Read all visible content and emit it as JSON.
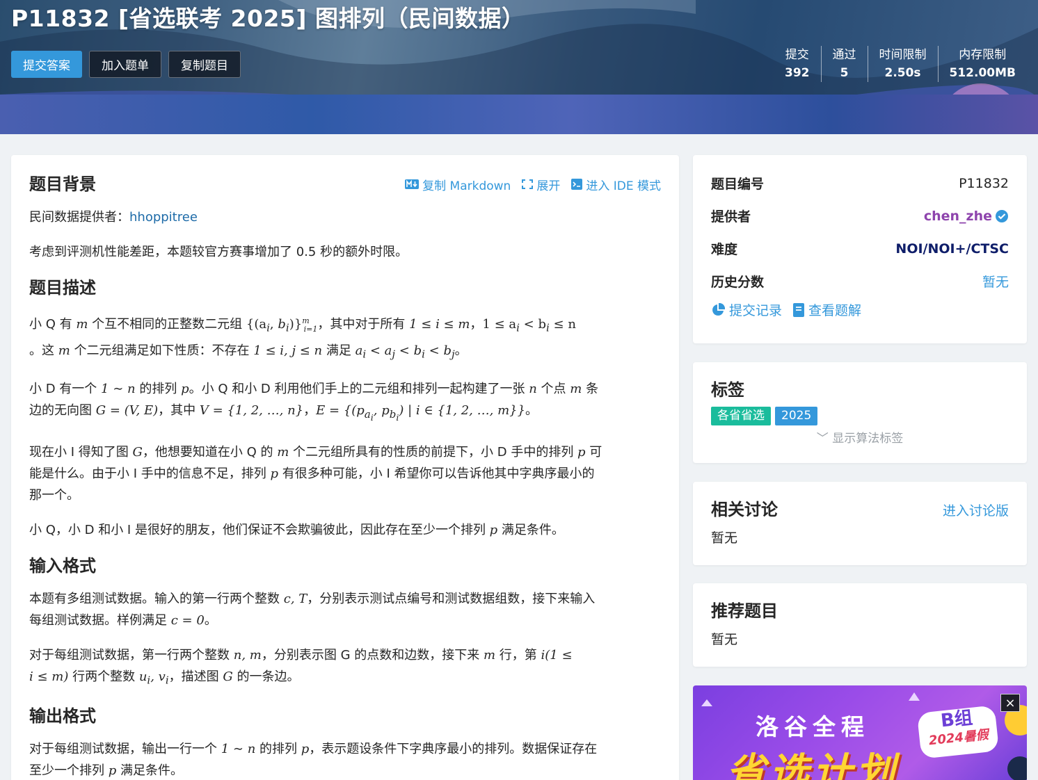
{
  "banner": {
    "title": "P11832 [省选联考 2025] 图排列（民间数据）",
    "buttons": {
      "submit": "提交答案",
      "add_list": "加入题单",
      "copy": "复制题目"
    },
    "stats": [
      {
        "label": "提交",
        "value": "392"
      },
      {
        "label": "通过",
        "value": "5"
      },
      {
        "label": "时间限制",
        "value": "2.50s"
      },
      {
        "label": "内存限制",
        "value": "512.00MB"
      }
    ]
  },
  "main": {
    "tools": {
      "copy_md": "复制 Markdown",
      "expand": "展开",
      "ide": "进入 IDE 模式"
    },
    "background": {
      "heading": "题目背景",
      "provider_prefix": "民间数据提供者：",
      "provider_name": "hhoppitree",
      "note": "考虑到评测机性能差距，本题较官方赛事增加了 0.5 秒的额外时限。"
    },
    "description": {
      "heading": "题目描述",
      "p1a": "小 Q 有 ",
      "p1b": " 个互不相同的正整数二元组 ",
      "p1c": "，其中对于所有 ",
      "p1d": "，",
      "p1e": "。这 ",
      "p1f": " 个二元组满足如下性质：不存在 ",
      "p1g": " 满足 ",
      "p1h": "。",
      "p2a": "小 D 有一个 ",
      "p2b": " 的排列 ",
      "p2c": "。小 Q 和小 D 利用他们手上的二元组和排列一起构建了一张 ",
      "p2d": " 个点 ",
      "p2e": " 条",
      "p2f": "边的无向图 ",
      "p2g": "，其中 ",
      "p2h": "，",
      "p2i": "。",
      "p3a": "现在小 I 得知了图 ",
      "p3b": "，他想要知道在小 Q 的 ",
      "p3c": " 个二元组所具有的性质的前提下，小 D 手中的排列 ",
      "p3d": " 可",
      "p3e": "能是什么。由于小 I 手中的信息不足，排列 ",
      "p3f": " 有很多种可能，小 I 希望你可以告诉他其中字典序最小的",
      "p3g": "那一个。",
      "p4a": "小 Q，小 D 和小 I 是很好的朋友，他们保证不会欺骗彼此，因此存在至少一个排列 ",
      "p4b": " 满足条件。"
    },
    "input": {
      "heading": "输入格式",
      "p1a": "本题有多组测试数据。输入的第一行两个整数 ",
      "p1b": "，分别表示测试点编号和测试数据组数，接下来输入",
      "p1c": "每组测试数据。样例满足 ",
      "p1d": "。",
      "p2a": "对于每组测试数据，第一行两个整数 ",
      "p2b": "，分别表示图 G 的点数和边数，接下来 ",
      "p2c": " 行，第 ",
      "p2e": " 行两个整数 ",
      "p2f": "，描述图 ",
      "p2g": " 的一条边。"
    },
    "output": {
      "heading": "输出格式",
      "p1a": "对于每组测试数据，输出一行一个 ",
      "p1b": " 的排列 ",
      "p1c": "，表示题设条件下字典序最小的排列。数据保证存在",
      "p1d": "至少一个排列 ",
      "p1e": " 满足条件。"
    },
    "math": {
      "m": "m",
      "n": "n",
      "p": "p",
      "G": "G",
      "pairs": "{(a",
      "i": "i",
      "cond1": "1 ≤ i ≤ m",
      "cond2": "1 ≤ a",
      "cond2b": " < b",
      "cond2c": " ≤ n",
      "ij": "1 ≤ i, j ≤ n",
      "ineq": "a",
      "range": "1 ∼ n",
      "GVE": "G = (V, E)",
      "V": "V = {1, 2, …, n}",
      "E": "E = {(p",
      "cT": "c, T",
      "c0": "c = 0",
      "nm": "n, m",
      "i_open": "i(1 ≤",
      "i_close": "i ≤ m)",
      "uv": "u"
    }
  },
  "info": {
    "rows": [
      {
        "label": "题目编号",
        "value": "P11832"
      },
      {
        "label": "提供者",
        "value": "chen_zhe"
      },
      {
        "label": "难度",
        "value": "NOI/NOI+/CTSC"
      },
      {
        "label": "历史分数",
        "value": "暂无"
      }
    ],
    "actions": {
      "records": "提交记录",
      "solutions": "查看题解"
    }
  },
  "tags": {
    "heading": "标签",
    "items": [
      "各省省选",
      "2025"
    ],
    "show": "显示算法标签"
  },
  "discuss": {
    "heading": "相关讨论",
    "link": "进入讨论版",
    "empty": "暂无"
  },
  "recommend": {
    "heading": "推荐题目",
    "empty": "暂无"
  },
  "ad": {
    "line1": "洛谷全程",
    "line2": "省选计划",
    "badge1": "B组",
    "badge2": "2024暑假",
    "close": "×"
  },
  "colors": {
    "primary": "#3498db",
    "provider": "#8e44ad",
    "tag1": "#1abc9c",
    "tag2": "#3498db",
    "difficulty": "#0e1d69"
  }
}
